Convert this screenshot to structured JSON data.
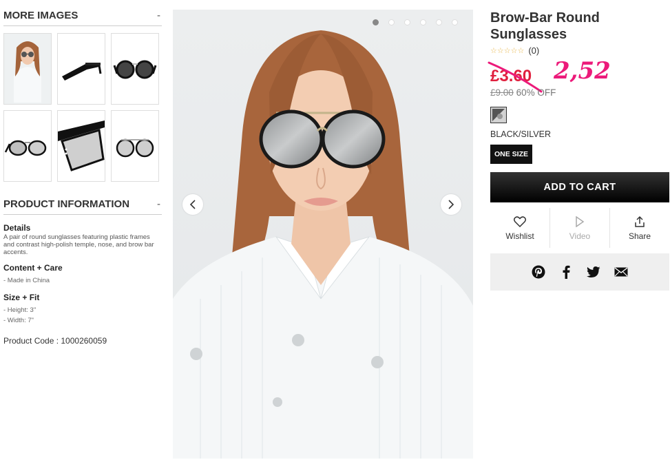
{
  "more_images": {
    "heading": "MORE IMAGES",
    "toggle": "-",
    "thumbnails": [
      "model-front",
      "sunglasses-side",
      "sunglasses-front",
      "sunglasses-angle",
      "sunglasses-closeup",
      "sunglasses-lens"
    ]
  },
  "product_info": {
    "heading": "PRODUCT INFORMATION",
    "toggle": "-",
    "details_title": "Details",
    "details_text": "A pair of round sunglasses featuring plastic frames and contrast high-polish temple, nose, and brow bar accents.",
    "care_title": "Content + Care",
    "care_items": [
      "- Made in China"
    ],
    "size_title": "Size + Fit",
    "size_items": [
      "- Height: 3\"",
      "- Width: 7\""
    ],
    "product_code": "Product Code : 1000260059"
  },
  "gallery": {
    "dot_count": 6,
    "active_dot": 1,
    "prev_icon": "chevron-left-icon",
    "next_icon": "chevron-right-icon"
  },
  "product": {
    "title": "Brow-Bar Round Sunglasses",
    "stars": "☆☆☆☆☆",
    "review_count": "(0)",
    "sale_price": "£3.60",
    "handwritten_price": "2,52",
    "original_price": "£9.00",
    "discount": "60% OFF",
    "color_name": "BLACK/SILVER",
    "size": "ONE SIZE",
    "add_to_cart": "ADD TO CART",
    "accent_color": "#e0203e",
    "handwritten_color": "#ec1a7a"
  },
  "actions": {
    "wishlist": "Wishlist",
    "video": "Video",
    "share": "Share"
  },
  "social": [
    "pinterest-icon",
    "facebook-icon",
    "twitter-icon",
    "email-icon"
  ]
}
